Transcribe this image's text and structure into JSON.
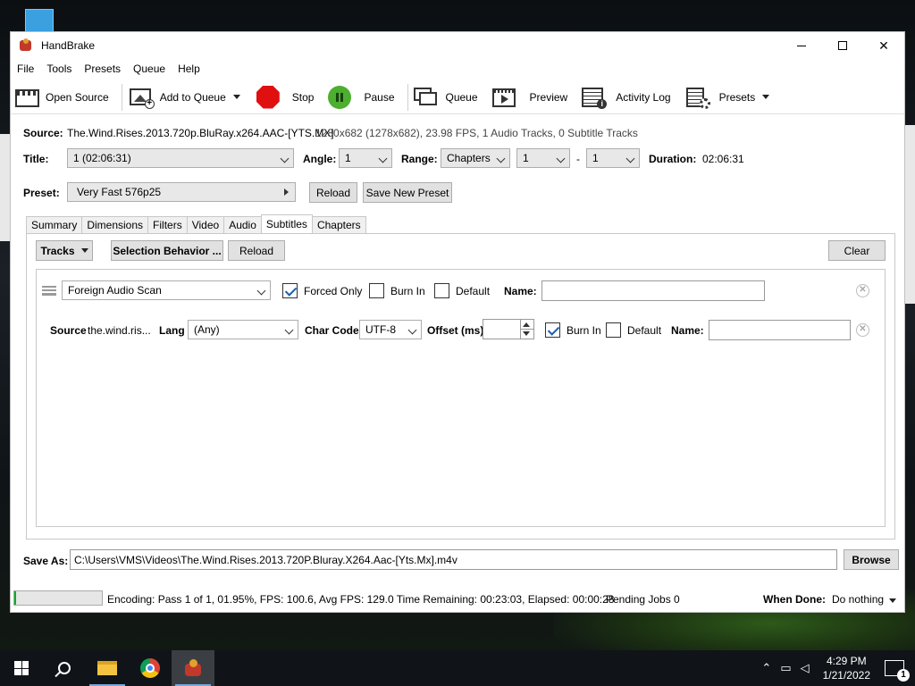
{
  "window": {
    "title": "HandBrake",
    "min": "",
    "close": "✕"
  },
  "menu": [
    "File",
    "Tools",
    "Presets",
    "Queue",
    "Help"
  ],
  "toolbar": {
    "open_source": "Open Source",
    "add_to_queue": "Add to Queue",
    "stop": "Stop",
    "pause": "Pause",
    "queue": "Queue",
    "preview": "Preview",
    "activity_log": "Activity Log",
    "presets": "Presets"
  },
  "source": {
    "label": "Source:",
    "name": "The.Wind.Rises.2013.720p.BluRay.x264.AAC-[YTS.MX]",
    "info": "1280x682 (1278x682), 23.98 FPS, 1 Audio Tracks, 0 Subtitle Tracks"
  },
  "title_row": {
    "title_label": "Title:",
    "title_value": "1 (02:06:31)",
    "angle_label": "Angle:",
    "angle_value": "1",
    "range_label": "Range:",
    "range_type": "Chapters",
    "range_start": "1",
    "range_sep": "-",
    "range_end": "1",
    "duration_label": "Duration:",
    "duration_value": "02:06:31"
  },
  "preset": {
    "label": "Preset:",
    "value": "Very Fast 576p25",
    "reload": "Reload",
    "save_new": "Save New Preset"
  },
  "tabs": [
    "Summary",
    "Dimensions",
    "Filters",
    "Video",
    "Audio",
    "Subtitles",
    "Chapters"
  ],
  "active_tab": "Subtitles",
  "subtitles": {
    "tracks_btn": "Tracks",
    "selection_behavior_btn": "Selection Behavior ...",
    "reload_btn": "Reload",
    "clear_btn": "Clear",
    "row1": {
      "track": "Foreign Audio Scan",
      "forced_only_label": "Forced Only",
      "forced_only": true,
      "burn_in_label": "Burn In",
      "burn_in": false,
      "default_label": "Default",
      "default": false,
      "name_label": "Name:",
      "name_value": ""
    },
    "row2": {
      "source_label": "Source",
      "source_value": "the.wind.ris...",
      "lang_label": "Lang",
      "lang_value": "(Any)",
      "charcode_label": "Char Code",
      "charcode_value": "UTF-8",
      "offset_label": "Offset (ms)",
      "offset_value": "",
      "burn_in_label": "Burn In",
      "burn_in": true,
      "default_label": "Default",
      "default": false,
      "name_label": "Name:",
      "name_value": ""
    }
  },
  "save_as": {
    "label": "Save As:",
    "path": "C:\\Users\\VMS\\Videos\\The.Wind.Rises.2013.720P.Bluray.X264.Aac-[Yts.Mx].m4v",
    "browse": "Browse"
  },
  "status": {
    "progress_percent": 1.95,
    "text": "Encoding: Pass 1 of 1,  01.95%, FPS: 100.6,  Avg FPS: 129.0 Time Remaining: 00:23:03,  Elapsed: 00:00:28",
    "pending": "Pending Jobs 0",
    "when_done_label": "When Done:",
    "when_done_value": "Do nothing"
  },
  "taskbar": {
    "time": "4:29 PM",
    "date": "1/21/2022",
    "notifications": "1"
  },
  "colors": {
    "progress": "#06b025",
    "stop": "#e01010",
    "pause": "#4caf2f",
    "taskbar": "#101418"
  }
}
